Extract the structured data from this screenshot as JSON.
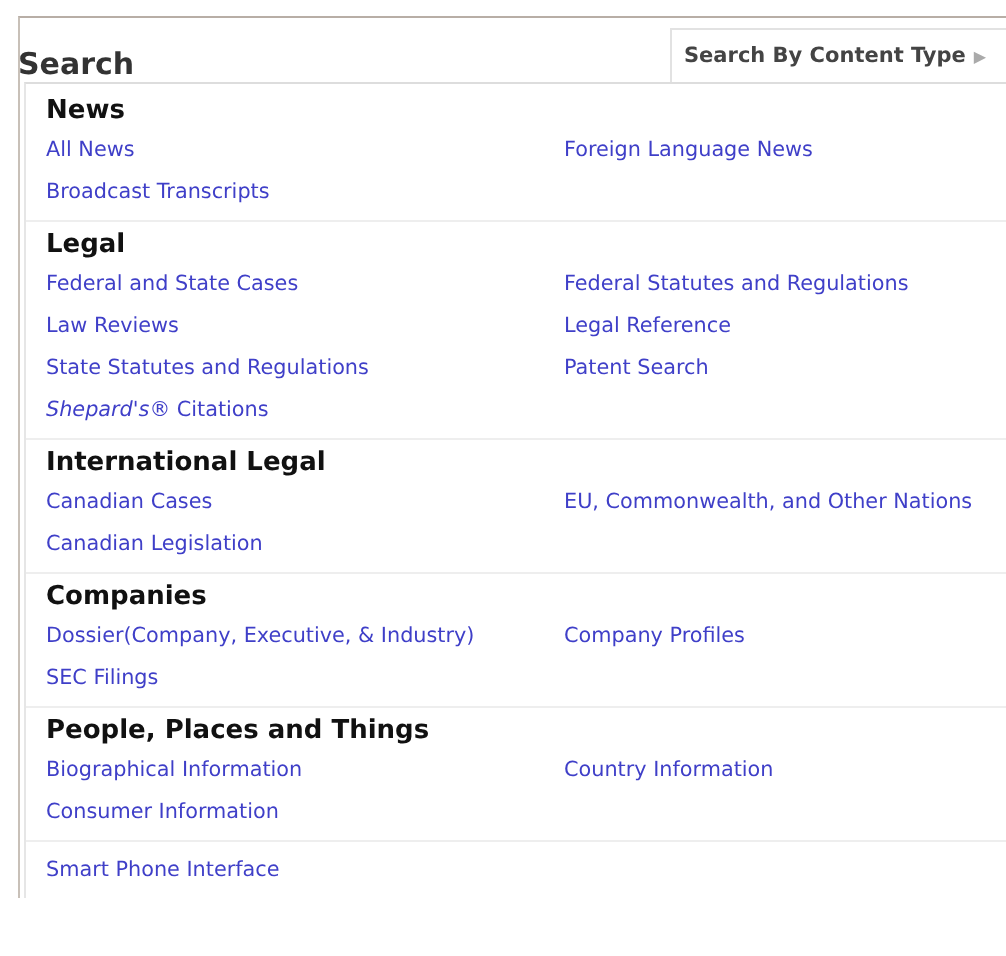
{
  "title": "Search",
  "content_type_button": {
    "label": "Search By Content Type",
    "arrow": "▶"
  },
  "sections": [
    {
      "heading": "News",
      "links": [
        "All News",
        "Foreign Language News",
        "Broadcast Transcripts"
      ]
    },
    {
      "heading": "Legal",
      "links": [
        "Federal and State Cases",
        "Federal Statutes and Regulations",
        "Law Reviews",
        "Legal Reference",
        "State Statutes and Regulations",
        "Patent Search",
        "*Shepard's*® Citations"
      ]
    },
    {
      "heading": "International Legal",
      "links": [
        "Canadian Cases",
        "EU, Commonwealth, and Other Nations",
        "Canadian Legislation"
      ]
    },
    {
      "heading": "Companies",
      "links": [
        "Dossier(Company, Executive, & Industry)",
        "Company Profiles",
        "SEC Filings"
      ]
    },
    {
      "heading": "People, Places and Things",
      "links": [
        "Biographical Information",
        "Country Information",
        "Consumer Information"
      ]
    },
    {
      "links": [
        "Smart Phone Interface"
      ]
    }
  ]
}
